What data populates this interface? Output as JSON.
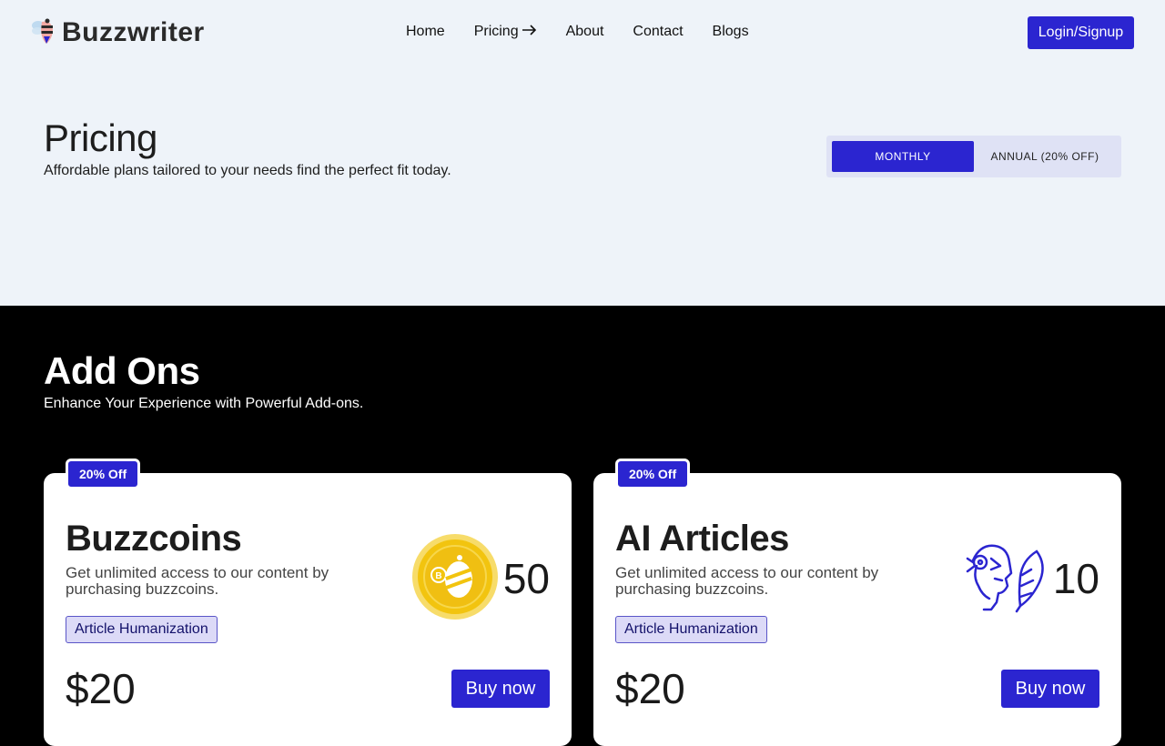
{
  "brand": {
    "name": "Buzzwriter",
    "logo_icon": "bee-icon"
  },
  "nav": {
    "links": [
      {
        "label": "Home"
      },
      {
        "label": "Pricing",
        "icon": "arrow-right-icon"
      },
      {
        "label": "About"
      },
      {
        "label": "Contact"
      },
      {
        "label": "Blogs"
      }
    ],
    "login_label": "Login/Signup"
  },
  "pricing": {
    "title": "Pricing",
    "subtitle": "Affordable plans tailored to your needs find the perfect fit today.",
    "toggle": {
      "monthly": "MONTHLY",
      "annual": "ANNUAL (20% OFF)",
      "selected": "monthly"
    }
  },
  "addons": {
    "title": "Add Ons",
    "subtitle": "Enhance Your Experience with Powerful Add-ons.",
    "cards": [
      {
        "badge": "20% Off",
        "name": "Buzzcoins",
        "description": "Get unlimited access to our content by purchasing buzzcoins.",
        "tag": "Article Humanization",
        "quantity": "50",
        "price": "$20",
        "button": "Buy now",
        "icon": "buzzcoin-icon"
      },
      {
        "badge": "20% Off",
        "name": "AI Articles",
        "description": "Get unlimited access to our content by purchasing buzzcoins.",
        "tag": "Article Humanization",
        "quantity": "10",
        "price": "$20",
        "button": "Buy now",
        "icon": "ai-writer-icon"
      }
    ]
  },
  "colors": {
    "accent": "#2b25d0",
    "hero_bg": "#eef3f9",
    "addons_bg": "#000000",
    "tag_bg": "#dcdaf7",
    "coin_gold": "#f2c40f"
  }
}
